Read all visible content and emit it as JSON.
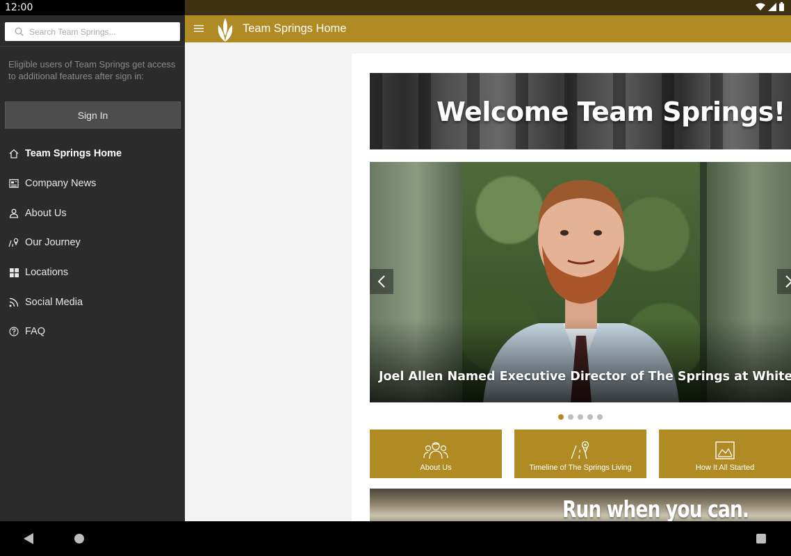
{
  "status_bar": {
    "time": "12:00"
  },
  "drawer": {
    "search_placeholder": "Search Team Springs...",
    "eligible_text": "Eligible users of Team Springs get access to additional features after sign in:",
    "sign_in_label": "Sign In",
    "items": [
      {
        "label": "Team Springs Home",
        "icon": "home-icon",
        "active": true
      },
      {
        "label": "Company News",
        "icon": "newspaper-icon",
        "active": false
      },
      {
        "label": "About Us",
        "icon": "person-icon",
        "active": false
      },
      {
        "label": "Our Journey",
        "icon": "road-pin-icon",
        "active": false
      },
      {
        "label": "Locations",
        "icon": "grid-icon",
        "active": false
      },
      {
        "label": "Social Media",
        "icon": "rss-icon",
        "active": false
      },
      {
        "label": "FAQ",
        "icon": "question-icon",
        "active": false
      }
    ]
  },
  "appbar": {
    "title": "Team Springs Home"
  },
  "content": {
    "welcome_title": "Welcome Team Springs!",
    "carousel": {
      "caption": "Joel Allen Named Executive Director of The Springs at Whitefish",
      "slide_count": 5,
      "active_slide": 1
    },
    "tiles": [
      {
        "label": "About Us",
        "icon": "team-icon"
      },
      {
        "label": "Timeline of The Springs Living",
        "icon": "road-pin-icon"
      },
      {
        "label": "How It All Started",
        "icon": "image-icon"
      }
    ],
    "banner_text": "Run when you can."
  },
  "colors": {
    "accent": "#b08a22",
    "drawer_bg": "#2b2b2b"
  }
}
